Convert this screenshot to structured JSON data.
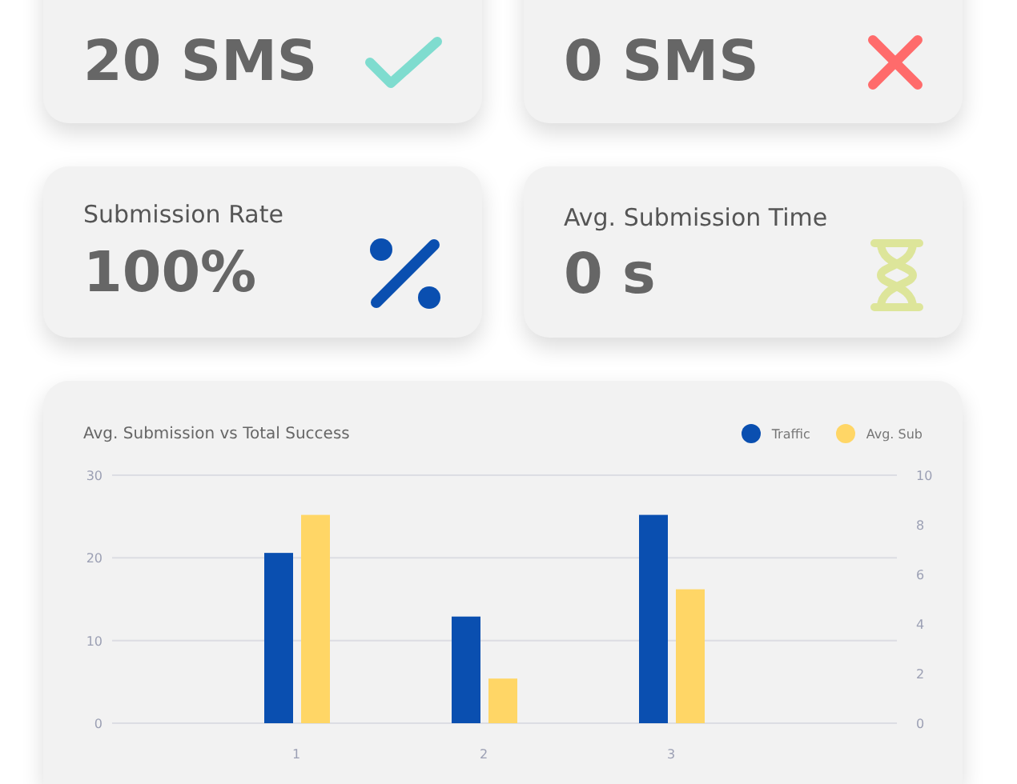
{
  "stat_cards": [
    {
      "value": "20 SMS",
      "kind": "success"
    },
    {
      "value": "0 SMS",
      "kind": "failure"
    },
    {
      "label": "Submission Rate",
      "value": "100%",
      "kind": "rate"
    },
    {
      "label": "Avg. Submission Time",
      "value": "0 s",
      "kind": "time"
    }
  ],
  "chart": {
    "chart_data": {
      "type": "bar",
      "title": "Avg. Submission vs Total Success",
      "categories": [
        "1",
        "2",
        "3"
      ],
      "series": [
        {
          "name": "Traffic",
          "color": "#0a4fb0",
          "values": [
            20.6,
            12.9,
            25.2
          ]
        }
      ],
      "ylim": [
        0,
        30
      ],
      "yticks": [
        0,
        10,
        20,
        30
      ]
    },
    "right_axis": {
      "chart_data": {
        "type": "bar",
        "series": [
          {
            "name": "Avg. Sub",
            "color": "#ffd666",
            "values": [
              8.4,
              1.8,
              5.4
            ]
          }
        ],
        "ylim": [
          0,
          10
        ],
        "yticks": [
          0,
          2,
          4,
          6,
          8,
          10
        ]
      }
    }
  }
}
